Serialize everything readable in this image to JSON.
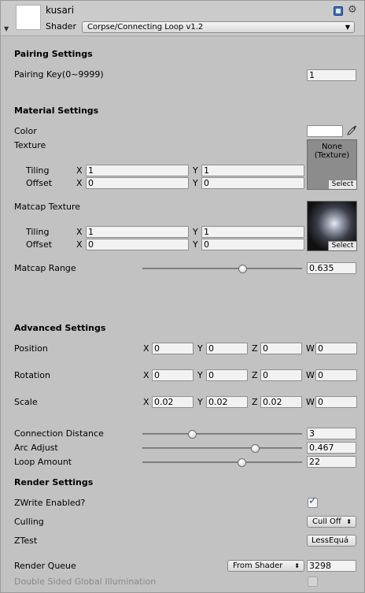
{
  "header": {
    "object_name": "kusari",
    "shader_label": "Shader",
    "shader_value": "Corpse/Connecting Loop v1.2"
  },
  "pairing": {
    "title": "Pairing Settings",
    "key_label": "Pairing Key(0~9999)",
    "key_value": "1"
  },
  "material": {
    "title": "Material Settings",
    "color_label": "Color",
    "color_value": "#ffffff",
    "texture_label": "Texture",
    "texture_none": "None",
    "texture_type": "(Texture)",
    "select_label": "Select",
    "tiling_label": "Tiling",
    "offset_label": "Offset",
    "x_label": "X",
    "y_label": "Y",
    "tex_tiling_x": "1",
    "tex_tiling_y": "1",
    "tex_offset_x": "0",
    "tex_offset_y": "0",
    "matcap_label": "Matcap Texture",
    "matcap_tiling_x": "1",
    "matcap_tiling_y": "1",
    "matcap_offset_x": "0",
    "matcap_offset_y": "0",
    "matcap_range_label": "Matcap Range",
    "matcap_range_value": "0.635",
    "matcap_range_fraction": 0.635
  },
  "advanced": {
    "title": "Advanced Settings",
    "axes": {
      "x": "X",
      "y": "Y",
      "z": "Z",
      "w": "W"
    },
    "position": {
      "label": "Position",
      "x": "0",
      "y": "0",
      "z": "0",
      "w": "0"
    },
    "rotation": {
      "label": "Rotation",
      "x": "0",
      "y": "0",
      "z": "0",
      "w": "0"
    },
    "scale": {
      "label": "Scale",
      "x": "0.02",
      "y": "0.02",
      "z": "0.02",
      "w": "0"
    },
    "connection_distance": {
      "label": "Connection Distance",
      "value": "3",
      "fraction": 0.3
    },
    "arc_adjust": {
      "label": "Arc Adjust",
      "value": "0.467",
      "fraction": 0.72
    },
    "loop_amount": {
      "label": "Loop Amount",
      "value": "22",
      "fraction": 0.63
    }
  },
  "render": {
    "title": "Render Settings",
    "zwrite_label": "ZWrite Enabled?",
    "zwrite_checked": true,
    "culling_label": "Culling",
    "culling_value": "Cull Off",
    "ztest_label": "ZTest",
    "ztest_value": "LessEquá",
    "queue_label": "Render Queue",
    "queue_mode": "From Shader",
    "queue_value": "3298",
    "dsgi_label": "Double Sided Global Illumination",
    "dsgi_checked": false
  },
  "icons": {
    "book": "book-icon",
    "settings": "gear-icon",
    "eyedropper": "eyedropper-icon",
    "foldout": "foldout-arrow-icon",
    "check": "checkmark-icon"
  },
  "colors": {
    "background": "#c2c2c2",
    "field": "#f2f2f2",
    "check_blue": "#1f4fa0"
  }
}
